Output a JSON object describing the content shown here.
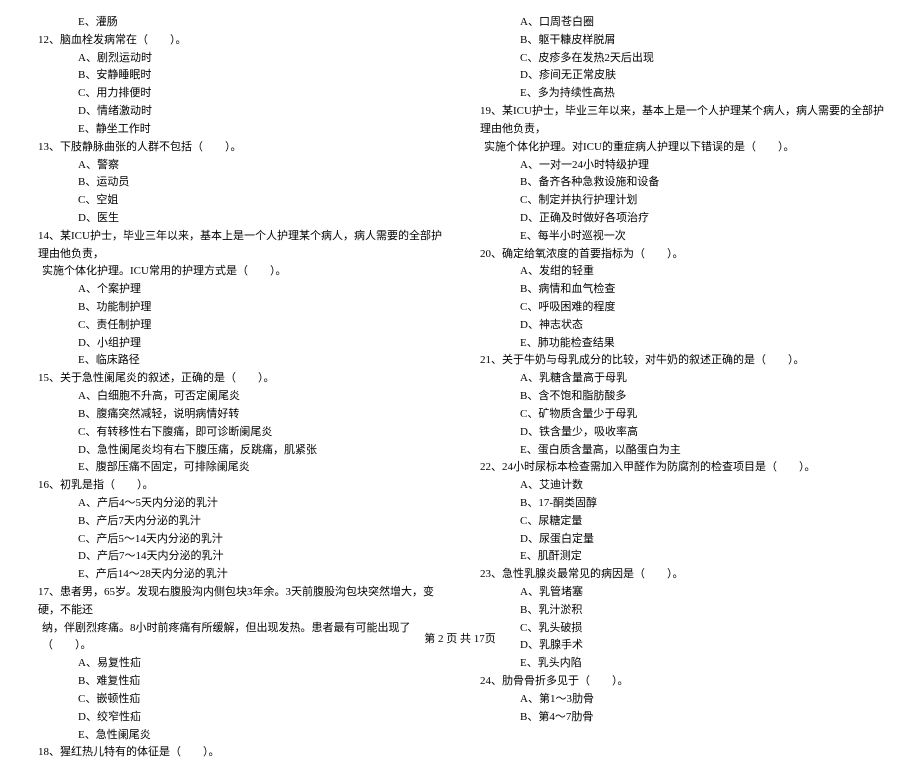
{
  "left": {
    "pre_options": [
      "E、灌肠"
    ],
    "questions": [
      {
        "num": "12",
        "text": "、脑血栓发病常在（　　）。",
        "options": [
          "A、剧烈运动时",
          "B、安静睡眠时",
          "C、用力排便时",
          "D、情绪激动时",
          "E、静坐工作时"
        ]
      },
      {
        "num": "13",
        "text": "、下肢静脉曲张的人群不包括（　　）。",
        "options": [
          "A、警察",
          "B、运动员",
          "C、空姐",
          "D、医生"
        ]
      },
      {
        "num": "14",
        "text": "、某ICU护士，毕业三年以来，基本上是一个人护理某个病人，病人需要的全部护理由他负责，",
        "cont": "实施个体化护理。ICU常用的护理方式是（　　）。",
        "options": [
          "A、个案护理",
          "B、功能制护理",
          "C、责任制护理",
          "D、小组护理",
          "E、临床路径"
        ]
      },
      {
        "num": "15",
        "text": "、关于急性阑尾炎的叙述，正确的是（　　）。",
        "options": [
          "A、白细胞不升高，可否定阑尾炎",
          "B、腹痛突然减轻，说明病情好转",
          "C、有转移性右下腹痛，即可诊断阑尾炎",
          "D、急性阑尾炎均有右下腹压痛，反跳痛，肌紧张",
          "E、腹部压痛不固定，可排除阑尾炎"
        ]
      },
      {
        "num": "16",
        "text": "、初乳是指（　　）。",
        "options": [
          "A、产后4～5天内分泌的乳汁",
          "B、产后7天内分泌的乳汁",
          "C、产后5～14天内分泌的乳汁",
          "D、产后7～14天内分泌的乳汁",
          "E、产后14～28天内分泌的乳汁"
        ]
      },
      {
        "num": "17",
        "text": "、患者男，65岁。发现右腹股沟内侧包块3年余。3天前腹股沟包块突然增大，变硬，不能还",
        "cont": "纳，伴剧烈疼痛。8小时前疼痛有所缓解，但出现发热。患者最有可能出现了（　　）。",
        "options": [
          "A、易复性疝",
          "B、难复性疝",
          "C、嵌顿性疝",
          "D、绞窄性疝",
          "E、急性阑尾炎"
        ]
      },
      {
        "num": "18",
        "text": "、猩红热儿特有的体征是（　　）。",
        "options": []
      }
    ]
  },
  "right": {
    "pre_options": [
      "A、口周苍白圈",
      "B、躯干糠皮样脱屑",
      "C、皮疹多在发热2天后出现",
      "D、疹间无正常皮肤",
      "E、多为持续性高热"
    ],
    "questions": [
      {
        "num": "19",
        "text": "、某ICU护士，毕业三年以来，基本上是一个人护理某个病人，病人需要的全部护理由他负责，",
        "cont": "实施个体化护理。对ICU的重症病人护理以下错误的是（　　）。",
        "options": [
          "A、一对一24小时特级护理",
          "B、备齐各种急救设施和设备",
          "C、制定并执行护理计划",
          "D、正确及时做好各项治疗",
          "E、每半小时巡视一次"
        ]
      },
      {
        "num": "20",
        "text": "、确定给氧浓度的首要指标为（　　）。",
        "options": [
          "A、发绀的轻重",
          "B、病情和血气检查",
          "C、呼吸困难的程度",
          "D、神志状态",
          "E、肺功能检查结果"
        ]
      },
      {
        "num": "21",
        "text": "、关于牛奶与母乳成分的比较，对牛奶的叙述正确的是（　　）。",
        "options": [
          "A、乳糖含量高于母乳",
          "B、含不饱和脂肪酸多",
          "C、矿物质含量少于母乳",
          "D、铁含量少，吸收率高",
          "E、蛋白质含量高，以酪蛋白为主"
        ]
      },
      {
        "num": "22",
        "text": "、24小时尿标本检查需加入甲醛作为防腐剂的检查项目是（　　）。",
        "options": [
          "A、艾迪计数",
          "B、17-酮类固醇",
          "C、尿糖定量",
          "D、尿蛋白定量",
          "E、肌酐测定"
        ]
      },
      {
        "num": "23",
        "text": "、急性乳腺炎最常见的病因是（　　）。",
        "options": [
          "A、乳管堵塞",
          "B、乳汁淤积",
          "C、乳头破损",
          "D、乳腺手术",
          "E、乳头内陷"
        ]
      },
      {
        "num": "24",
        "text": "、肋骨骨折多见于（　　）。",
        "options": [
          "A、第1～3肋骨",
          "B、第4～7肋骨"
        ]
      }
    ]
  },
  "footer": {
    "prefix": "第 ",
    "page_num": "2",
    "middle": " 页 共 ",
    "total": "17",
    "suffix": "页"
  }
}
